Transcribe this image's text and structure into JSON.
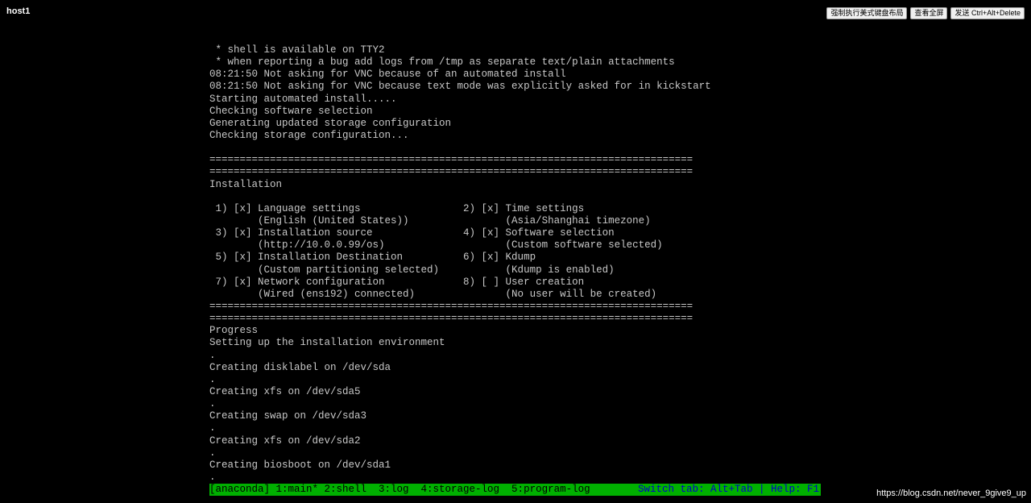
{
  "header": {
    "title": "host1",
    "buttons": {
      "keyboard_layout": "强制执行美式键盘布局",
      "fullscreen": "查看全屏",
      "ctrl_alt_delete": "发送 Ctrl+Alt+Delete"
    }
  },
  "terminal": {
    "lines": [
      " * shell is available on TTY2",
      " * when reporting a bug add logs from /tmp as separate text/plain attachments",
      "08:21:50 Not asking for VNC because of an automated install",
      "08:21:50 Not asking for VNC because text mode was explicitly asked for in kickstart",
      "Starting automated install.....",
      "Checking software selection",
      "Generating updated storage configuration",
      "Checking storage configuration...",
      "",
      "================================================================================",
      "================================================================================",
      "Installation",
      "",
      " 1) [x] Language settings                 2) [x] Time settings",
      "        (English (United States))                (Asia/Shanghai timezone)",
      " 3) [x] Installation source               4) [x] Software selection",
      "        (http://10.0.0.99/os)                    (Custom software selected)",
      " 5) [x] Installation Destination          6) [x] Kdump",
      "        (Custom partitioning selected)           (Kdump is enabled)",
      " 7) [x] Network configuration             8) [ ] User creation",
      "        (Wired (ens192) connected)               (No user will be created)",
      "================================================================================",
      "================================================================================",
      "Progress",
      "Setting up the installation environment",
      ".",
      "Creating disklabel on /dev/sda",
      ".",
      "Creating xfs on /dev/sda5",
      ".",
      "Creating swap on /dev/sda3",
      ".",
      "Creating xfs on /dev/sda2",
      ".",
      "Creating biosboot on /dev/sda1",
      "."
    ],
    "status_left": "[anaconda] 1:main* 2:shell  3:log  4:storage-log  5:program-log",
    "status_right": "Switch tab: Alt+Tab | Help: F1"
  },
  "watermark": "https://blog.csdn.net/never_9give9_up"
}
